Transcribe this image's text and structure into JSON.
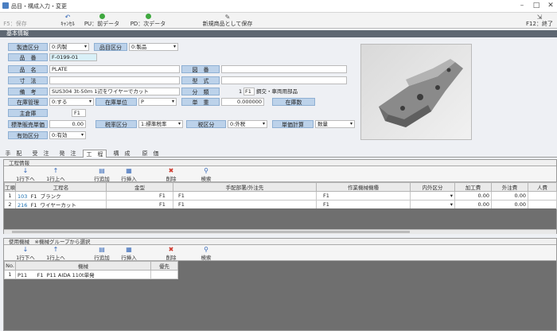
{
  "window": {
    "title": "品目・構成入力・変更"
  },
  "toolbar": {
    "f5": "F5：保存",
    "cancel": "ｷｬﾝｾﾙ",
    "pu": "PU：前データ",
    "pd": "PD：次データ",
    "save_new": "新規商品として保存",
    "f12": "F12：終了"
  },
  "basic": {
    "header": "基本情報",
    "seizo_kubun_label": "製造区分",
    "seizo_kubun_value": "0:内製",
    "hinmoku_kubun_label": "品目区分",
    "hinmoku_kubun_value": "0:製品",
    "hinban_label": "品　番",
    "hinban_value": "F-0199-01",
    "hinmei_label": "品　名",
    "hinmei_value": "PLATE",
    "zuban_label": "図　番",
    "zuban_value": "",
    "sunpo_label": "寸　法",
    "sunpo_value": "",
    "katashiki_label": "型　式",
    "katashiki_value": "",
    "biko_label": "備　考",
    "biko_value": "SUS304 3t-50ｍ 1辺をワイヤーでカット",
    "bunrui_label": "分　類",
    "bunrui_num": "1",
    "bunrui_code": "F1",
    "bunrui_value": "鋼交・車両用部品",
    "zaiko_kanri_label": "在庫管理",
    "zaiko_kanri_value": "0:する",
    "zaiko_tani_label": "在庫単位",
    "zaiko_tani_value": "P",
    "tanju_label": "単　重",
    "tanju_value": "0.000000",
    "zaikosu_label": "在庫数",
    "shusoko_label": "主倉庫",
    "shusoko_value": "F1",
    "hyojun_label": "標準販売単価",
    "hyojun_value": "0.00",
    "zeirtsu_label": "税率区分",
    "zeiritsu_value": "1:標準税率",
    "zei_kubun_label": "税区分",
    "zei_kubun_value": "0:外税",
    "tanka_keisan_label": "単価計算",
    "tanka_keisan_value": "数量",
    "yuko_label": "有効区分",
    "yuko_value": "0:有効"
  },
  "tabs": [
    "手　配",
    "受　注",
    "発　注",
    "工　程",
    "構　成",
    "原　価"
  ],
  "process": {
    "header": "工程情報",
    "buttons": [
      "1行下へ",
      "1行上へ",
      "行追加",
      "行挿入",
      "削除",
      "検索"
    ],
    "columns": [
      "工順",
      "工程名",
      "金型",
      "手配部署/外注先",
      "作業機械機種",
      "内外区分",
      "加工費",
      "外注費",
      "人費"
    ],
    "rows": [
      {
        "no": "1",
        "code": "103",
        "dept": "F1",
        "name": "ブランク",
        "kanagata": "F1",
        "tehai": "F1",
        "kikai": "F1",
        "cost1": "0.00",
        "cost2": "0.00"
      },
      {
        "no": "2",
        "code": "216",
        "dept": "F1",
        "name": "ワイヤーカット",
        "kanagata": "F1",
        "tehai": "F1",
        "kikai": "F1",
        "cost1": "0.00",
        "cost2": "0.00"
      }
    ]
  },
  "machine": {
    "header": "使用機械　※機械グループから選択",
    "buttons": [
      "1行下へ",
      "1行上へ",
      "行追加",
      "行挿入",
      "削除",
      "検索"
    ],
    "columns": [
      "No.",
      "機械",
      "優先"
    ],
    "rows": [
      {
        "no": "1",
        "code": "P11",
        "dept": "F1",
        "name": "P11 AIDA 110t単発"
      }
    ]
  },
  "colors": {
    "section": "#5e6772",
    "label_bg": "#bcd2ea",
    "accent_green": "#3fa83f",
    "accent_red": "#d03a2f"
  }
}
